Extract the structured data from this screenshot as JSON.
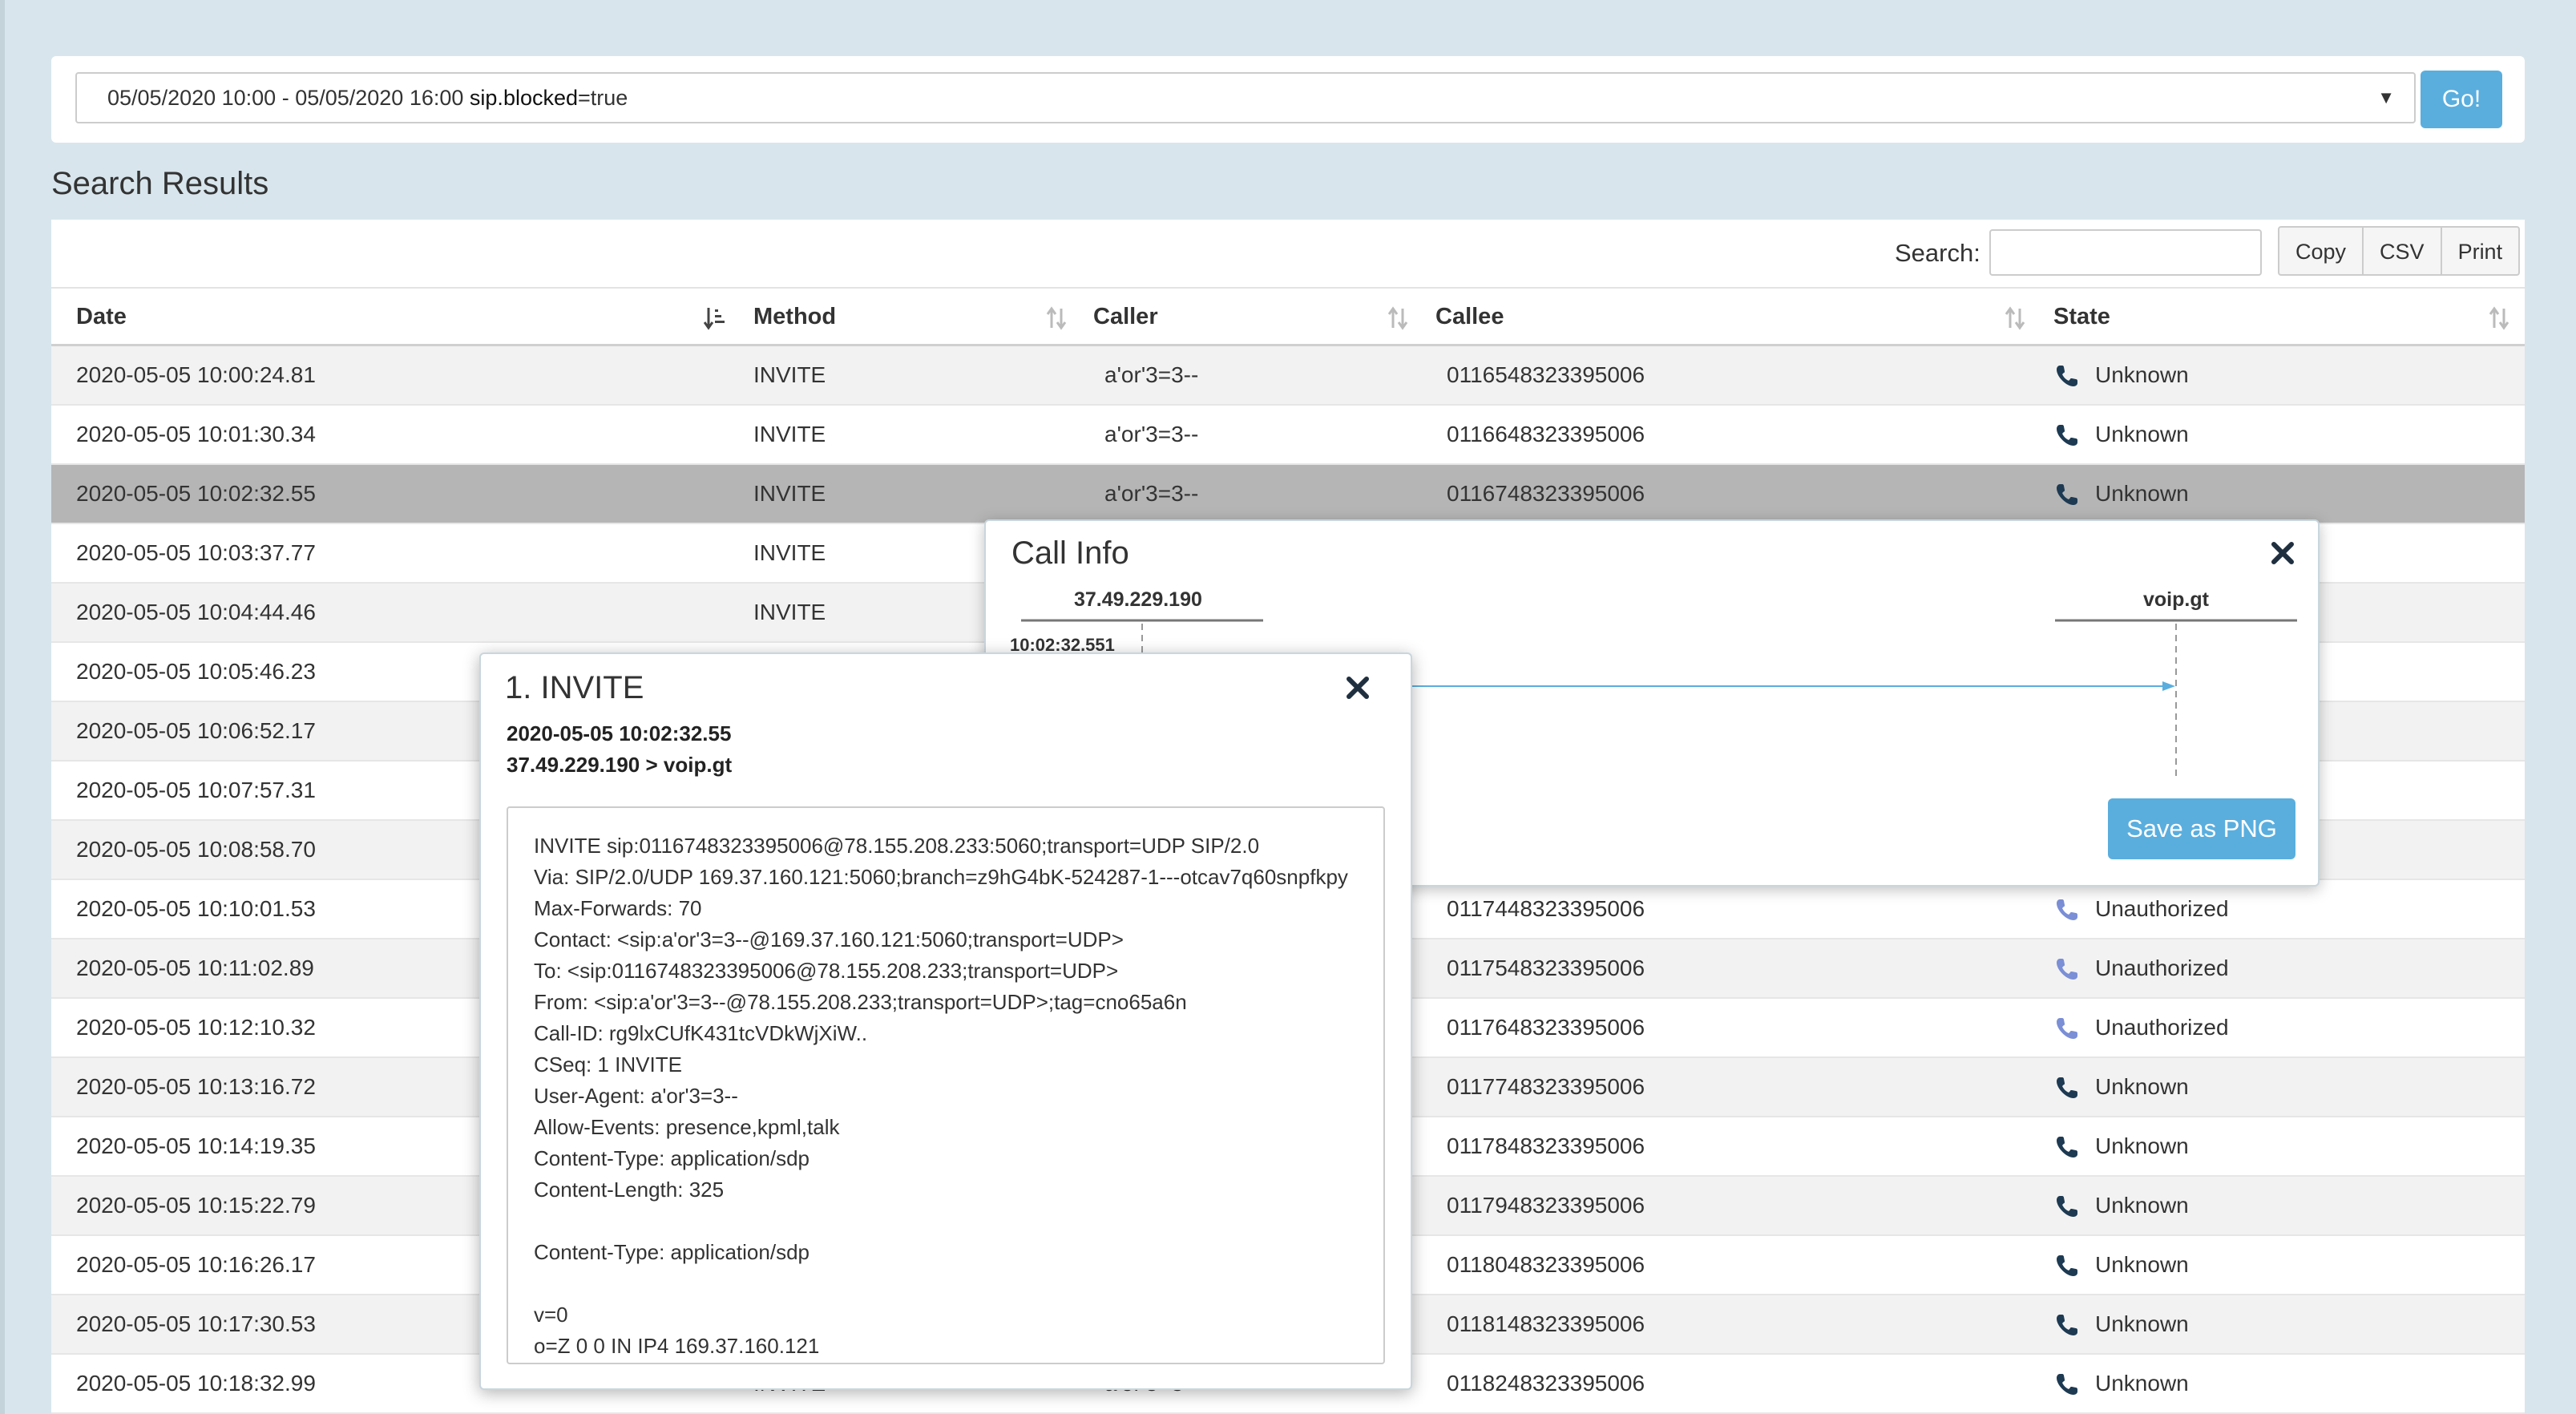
{
  "query": {
    "date_range": "05/05/2020 10:00 - 05/05/2020 16:00",
    "filter_key": "sip.blocked",
    "filter_value": "=true",
    "go_label": "Go!"
  },
  "results": {
    "heading": "Search Results",
    "search_label": "Search:",
    "search_value": "",
    "buttons": {
      "copy": "Copy",
      "csv": "CSV",
      "print": "Print"
    },
    "columns": {
      "date": "Date",
      "method": "Method",
      "caller": "Caller",
      "callee": "Callee",
      "state": "State"
    },
    "rows": [
      {
        "date": "2020-05-05 10:00:24.81",
        "method": "INVITE",
        "caller": "a'or'3=3--",
        "callee": "0116548323395006",
        "state": "Unknown"
      },
      {
        "date": "2020-05-05 10:01:30.34",
        "method": "INVITE",
        "caller": "a'or'3=3--",
        "callee": "0116648323395006",
        "state": "Unknown"
      },
      {
        "date": "2020-05-05 10:02:32.55",
        "method": "INVITE",
        "caller": "a'or'3=3--",
        "callee": "0116748323395006",
        "state": "Unknown"
      },
      {
        "date": "2020-05-05 10:03:37.77",
        "method": "INVITE",
        "caller": "",
        "callee": "",
        "state": ""
      },
      {
        "date": "2020-05-05 10:04:44.46",
        "method": "INVITE",
        "caller": "",
        "callee": "",
        "state": ""
      },
      {
        "date": "2020-05-05 10:05:46.23",
        "method": "",
        "caller": "",
        "callee": "",
        "state": ""
      },
      {
        "date": "2020-05-05 10:06:52.17",
        "method": "",
        "caller": "",
        "callee": "",
        "state": ""
      },
      {
        "date": "2020-05-05 10:07:57.31",
        "method": "",
        "caller": "",
        "callee": "",
        "state": ""
      },
      {
        "date": "2020-05-05 10:08:58.70",
        "method": "",
        "caller": "",
        "callee": "",
        "state": ""
      },
      {
        "date": "2020-05-05 10:10:01.53",
        "method": "",
        "caller": "",
        "callee": "0117448323395006",
        "state": "Unauthorized"
      },
      {
        "date": "2020-05-05 10:11:02.89",
        "method": "",
        "caller": "",
        "callee": "0117548323395006",
        "state": "Unauthorized"
      },
      {
        "date": "2020-05-05 10:12:10.32",
        "method": "",
        "caller": "",
        "callee": "0117648323395006",
        "state": "Unauthorized"
      },
      {
        "date": "2020-05-05 10:13:16.72",
        "method": "",
        "caller": "",
        "callee": "0117748323395006",
        "state": "Unknown"
      },
      {
        "date": "2020-05-05 10:14:19.35",
        "method": "",
        "caller": "",
        "callee": "0117848323395006",
        "state": "Unknown"
      },
      {
        "date": "2020-05-05 10:15:22.79",
        "method": "",
        "caller": "",
        "callee": "0117948323395006",
        "state": "Unknown"
      },
      {
        "date": "2020-05-05 10:16:26.17",
        "method": "",
        "caller": "",
        "callee": "0118048323395006",
        "state": "Unknown"
      },
      {
        "date": "2020-05-05 10:17:30.53",
        "method": "",
        "caller": "",
        "callee": "0118148323395006",
        "state": "Unknown"
      },
      {
        "date": "2020-05-05 10:18:32.99",
        "method": "INVITE",
        "caller": "a'or'3=3",
        "callee": "0118248323395006",
        "state": "Unknown"
      }
    ]
  },
  "call_info": {
    "title": "Call Info",
    "node_a": "37.49.229.190",
    "node_b": "voip.gt",
    "timestamp": "10:02:32.551",
    "save_label": "Save as PNG"
  },
  "invite": {
    "title": "1. INVITE",
    "datetime": "2020-05-05 10:02:32.55",
    "route": "37.49.229.190 > voip.gt",
    "message": [
      "INVITE sip:0116748323395006@78.155.208.233:5060;transport=UDP SIP/2.0",
      "Via: SIP/2.0/UDP 169.37.160.121:5060;branch=z9hG4bK-524287-1---otcav7q60snpfkpy",
      "Max-Forwards: 70",
      "Contact: <sip:a'or'3=3--@169.37.160.121:5060;transport=UDP>",
      "To: <sip:0116748323395006@78.155.208.233;transport=UDP>",
      "From: <sip:a'or'3=3--@78.155.208.233;transport=UDP>;tag=cno65a6n",
      "Call-ID: rg9lxCUfK431tcVDkWjXiW..",
      "CSeq: 1 INVITE",
      "User-Agent: a'or'3=3--",
      "Allow-Events: presence,kpml,talk",
      "Content-Type: application/sdp",
      "Content-Length: 325",
      "",
      "Content-Type: application/sdp",
      "",
      "v=0",
      "o=Z 0 0 IN IP4 169.37.160.121"
    ]
  },
  "colors": {
    "accent": "#5aaede",
    "phone_unknown": "#1d3a52",
    "phone_unauthorized": "#7b8fd6",
    "selected_row": "#b5b5b5",
    "page_bg": "#d8e5ec"
  },
  "icons": {
    "sort_active": "sort-amount-down-icon",
    "sort": "sort-arrows-icon",
    "state": "phone-icon",
    "close": "close-icon",
    "dropdown": "caret-down-icon"
  }
}
